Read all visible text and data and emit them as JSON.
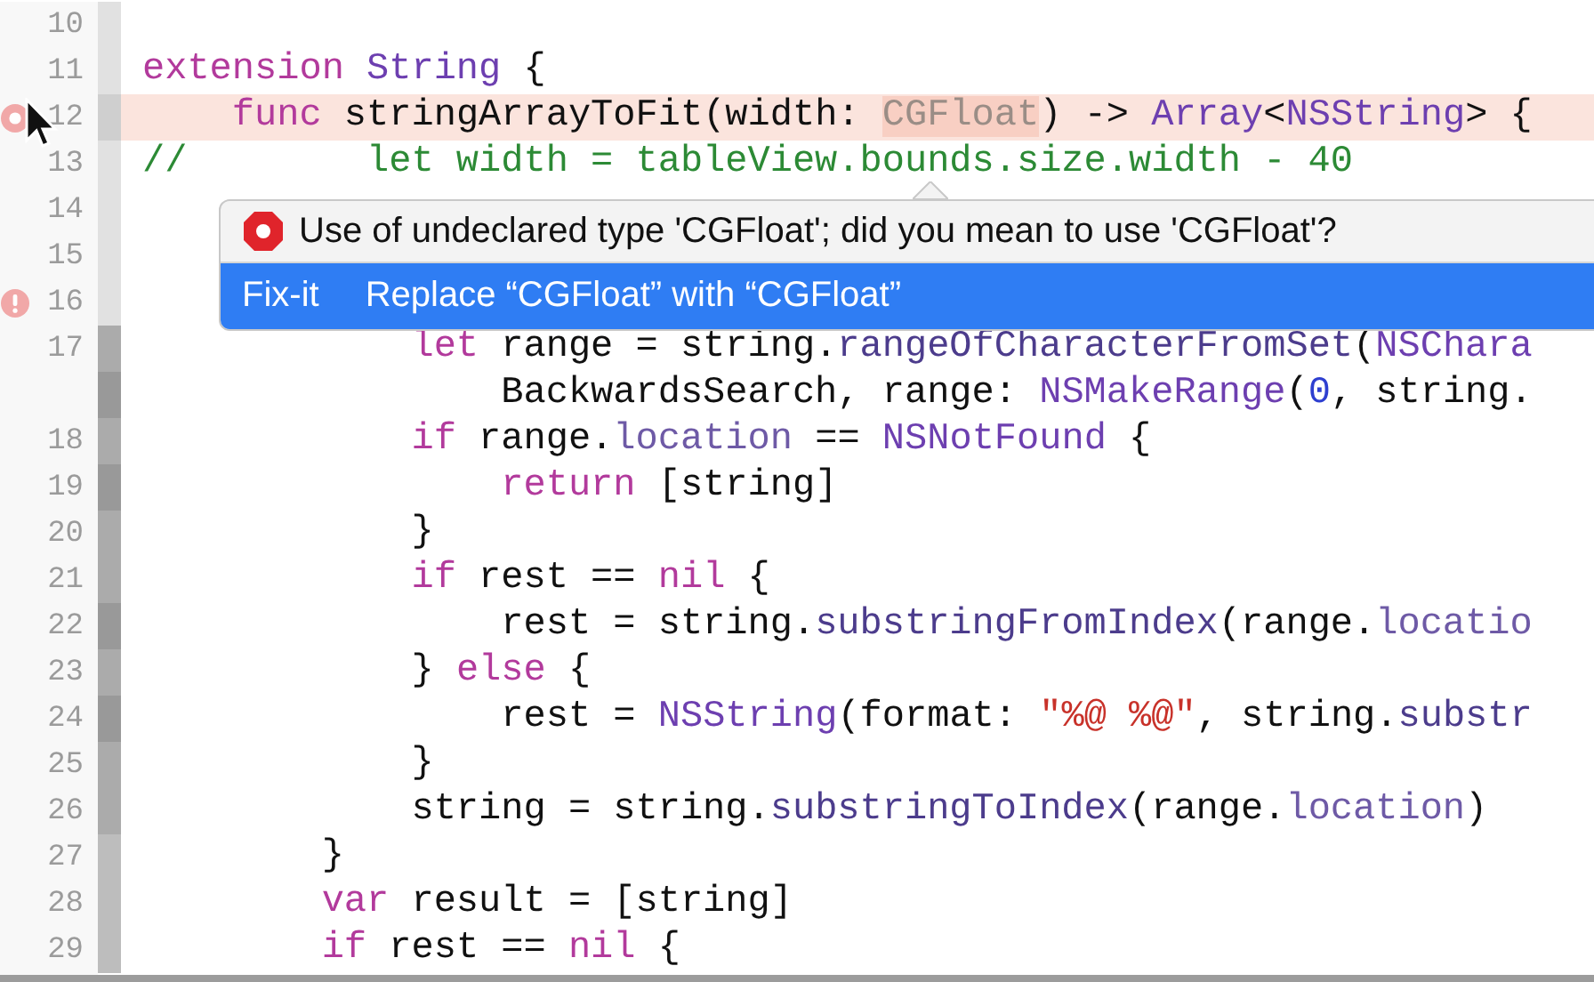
{
  "editor": {
    "lines": [
      {
        "number": "10"
      },
      {
        "number": "11",
        "tokens": [
          {
            "kind": "keyword",
            "text": "extension"
          },
          {
            "kind": "type",
            "text": " String"
          },
          {
            "kind": "plain",
            "text": " {"
          }
        ]
      },
      {
        "number": "12",
        "error": true,
        "tokens": [
          {
            "kind": "keyword",
            "text": "    func"
          },
          {
            "kind": "plain",
            "text": " stringArrayToFit(width: "
          },
          {
            "kind": "error",
            "text": "CGFloat"
          },
          {
            "kind": "plain",
            "text": ") -> "
          },
          {
            "kind": "type",
            "text": "Array"
          },
          {
            "kind": "plain",
            "text": "<"
          },
          {
            "kind": "type",
            "text": "NSString"
          },
          {
            "kind": "plain",
            "text": "> {"
          }
        ]
      },
      {
        "number": "13",
        "tokens": [
          {
            "kind": "comment",
            "text": "//        let width = tableView.bounds.size.width - 40"
          }
        ]
      },
      {
        "number": "14"
      },
      {
        "number": "15"
      },
      {
        "number": "16",
        "warning": true
      },
      {
        "number": "17",
        "tokens": [
          {
            "kind": "keyword",
            "text": "            let"
          },
          {
            "kind": "plain",
            "text": " range = string."
          },
          {
            "kind": "method",
            "text": "rangeOfCharacterFromSet"
          },
          {
            "kind": "plain",
            "text": "("
          },
          {
            "kind": "type",
            "text": "NSChara"
          }
        ]
      },
      {
        "tokens": [
          {
            "kind": "plain",
            "text": "                BackwardsSearch, range: "
          },
          {
            "kind": "type",
            "text": "NSMakeRange"
          },
          {
            "kind": "plain",
            "text": "("
          },
          {
            "kind": "number",
            "text": "0"
          },
          {
            "kind": "plain",
            "text": ", string."
          }
        ]
      },
      {
        "number": "18",
        "tokens": [
          {
            "kind": "keyword",
            "text": "            if"
          },
          {
            "kind": "plain",
            "text": " range."
          },
          {
            "kind": "property",
            "text": "location"
          },
          {
            "kind": "plain",
            "text": " == "
          },
          {
            "kind": "type",
            "text": "NSNotFound"
          },
          {
            "kind": "plain",
            "text": " {"
          }
        ]
      },
      {
        "number": "19",
        "tokens": [
          {
            "kind": "keyword",
            "text": "                return"
          },
          {
            "kind": "plain",
            "text": " [string]"
          }
        ]
      },
      {
        "number": "20",
        "tokens": [
          {
            "kind": "plain",
            "text": "            }"
          }
        ]
      },
      {
        "number": "21",
        "tokens": [
          {
            "kind": "keyword",
            "text": "            if"
          },
          {
            "kind": "plain",
            "text": " rest == "
          },
          {
            "kind": "keyword",
            "text": "nil"
          },
          {
            "kind": "plain",
            "text": " {"
          }
        ]
      },
      {
        "number": "22",
        "tokens": [
          {
            "kind": "plain",
            "text": "                rest = string."
          },
          {
            "kind": "method",
            "text": "substringFromIndex"
          },
          {
            "kind": "plain",
            "text": "(range."
          },
          {
            "kind": "property",
            "text": "locatio"
          }
        ]
      },
      {
        "number": "23",
        "tokens": [
          {
            "kind": "plain",
            "text": "            } "
          },
          {
            "kind": "keyword",
            "text": "else"
          },
          {
            "kind": "plain",
            "text": " {"
          }
        ]
      },
      {
        "number": "24",
        "tokens": [
          {
            "kind": "plain",
            "text": "                rest = "
          },
          {
            "kind": "type",
            "text": "NSString"
          },
          {
            "kind": "plain",
            "text": "(format: "
          },
          {
            "kind": "string",
            "text": "\"%@ %@\""
          },
          {
            "kind": "plain",
            "text": ", string."
          },
          {
            "kind": "method",
            "text": "substr"
          }
        ]
      },
      {
        "number": "25",
        "tokens": [
          {
            "kind": "plain",
            "text": "            }"
          }
        ]
      },
      {
        "number": "26",
        "tokens": [
          {
            "kind": "plain",
            "text": "            string = string."
          },
          {
            "kind": "method",
            "text": "substringToIndex"
          },
          {
            "kind": "plain",
            "text": "(range."
          },
          {
            "kind": "property",
            "text": "location"
          },
          {
            "kind": "plain",
            "text": ")"
          }
        ]
      },
      {
        "number": "27",
        "tokens": [
          {
            "kind": "plain",
            "text": "        }"
          }
        ]
      },
      {
        "number": "28",
        "tokens": [
          {
            "kind": "keyword",
            "text": "        var"
          },
          {
            "kind": "plain",
            "text": " result = [string]"
          }
        ]
      },
      {
        "number": "29",
        "tokens": [
          {
            "kind": "keyword",
            "text": "        if"
          },
          {
            "kind": "plain",
            "text": " rest == "
          },
          {
            "kind": "keyword",
            "text": "nil"
          },
          {
            "kind": "plain",
            "text": " {"
          }
        ]
      }
    ]
  },
  "issue_popup": {
    "message": "Use of undeclared type 'CGFloat'; did you mean to use 'CGFloat'?",
    "fixits": [
      {
        "label": "Fix-it",
        "text": "Replace “CGFloat” with “CGFloat”",
        "selected": true
      }
    ]
  }
}
